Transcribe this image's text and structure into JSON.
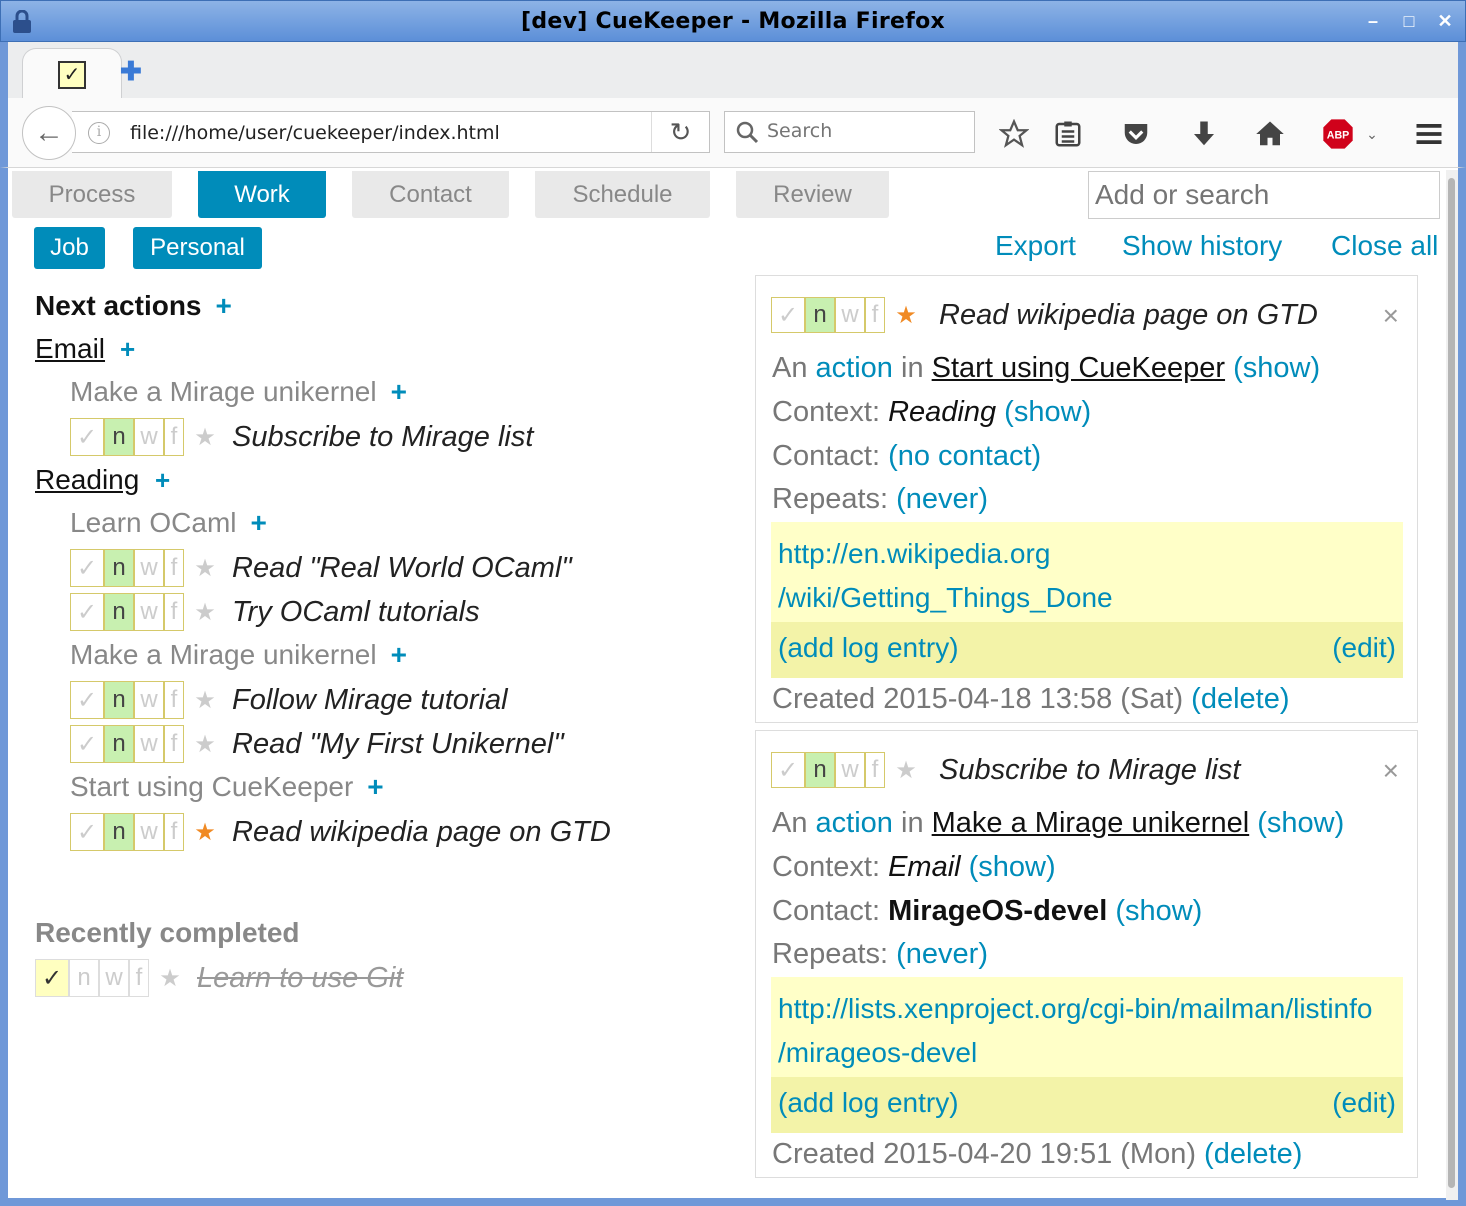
{
  "window": {
    "title": "[dev] CueKeeper - Mozilla Firefox"
  },
  "browser": {
    "tab_favicon": "✓",
    "url": "file:///home/user/cuekeeper/index.html",
    "search_placeholder": "Search",
    "icons": [
      "bookmark-star-icon",
      "reading-list-icon",
      "pocket-icon",
      "download-icon",
      "home-icon",
      "adblock-icon",
      "menu-icon"
    ],
    "adblock_label": "ABP"
  },
  "app": {
    "tabs": [
      {
        "label": "Process"
      },
      {
        "label": "Work"
      },
      {
        "label": "Contact"
      },
      {
        "label": "Schedule"
      },
      {
        "label": "Review"
      }
    ],
    "active_tab": "Work",
    "search_placeholder": "Add or search",
    "filters": [
      {
        "label": "Job"
      },
      {
        "label": "Personal"
      }
    ],
    "links": {
      "export": "Export",
      "history": "Show history",
      "close_all": "Close all"
    }
  },
  "work": {
    "next_actions_title": "Next actions",
    "plus": "+",
    "contexts": [
      {
        "name": "Email",
        "projects": [
          {
            "name": "Make a Mirage unikernel",
            "actions": [
              {
                "title": "Subscribe to Mirage list",
                "starred": false
              }
            ]
          }
        ]
      },
      {
        "name": "Reading",
        "projects": [
          {
            "name": "Learn OCaml",
            "actions": [
              {
                "title": "Read \"Real World OCaml\"",
                "starred": false
              },
              {
                "title": "Try OCaml tutorials",
                "starred": false
              }
            ]
          },
          {
            "name": "Make a Mirage unikernel",
            "actions": [
              {
                "title": "Follow Mirage tutorial",
                "starred": false
              },
              {
                "title": "Read \"My First Unikernel\"",
                "starred": false
              }
            ]
          },
          {
            "name": "Start using CueKeeper",
            "actions": [
              {
                "title": "Read wikipedia page on GTD",
                "starred": true
              }
            ]
          }
        ]
      }
    ],
    "state_letters": {
      "done": "✓",
      "next": "n",
      "waiting": "w",
      "future": "f",
      "star": "★"
    },
    "recently_completed_title": "Recently completed",
    "completed": [
      {
        "title": "Learn to use Git"
      }
    ]
  },
  "panels": [
    {
      "title": "Read wikipedia page on GTD",
      "starred": true,
      "close": "×",
      "action_prefix": "An",
      "action_word": "action",
      "in_word": "in",
      "project": "Start using CueKeeper",
      "show": "(show)",
      "context_label": "Context:",
      "context": "Reading",
      "contact_label": "Contact:",
      "contact": "(no contact)",
      "repeats_label": "Repeats:",
      "repeats": "(never)",
      "notes_line1": "http://en.wikipedia.org",
      "notes_line2": "/wiki/Getting_Things_Done",
      "add_log": "(add log entry)",
      "edit": "(edit)",
      "created": "Created 2015-04-18 13:58 (Sat)",
      "delete": "(delete)"
    },
    {
      "title": "Subscribe to Mirage list",
      "starred": false,
      "close": "×",
      "action_prefix": "An",
      "action_word": "action",
      "in_word": "in",
      "project": "Make a Mirage unikernel",
      "show": "(show)",
      "context_label": "Context:",
      "context": "Email",
      "contact_label": "Contact:",
      "contact": "MirageOS-devel",
      "repeats_label": "Repeats:",
      "repeats": "(never)",
      "notes_line1": "http://lists.xenproject.org/cgi-bin/mailman/listinfo",
      "notes_line2": "/mirageos-devel",
      "add_log": "(add log entry)",
      "edit": "(edit)",
      "created": "Created 2015-04-20 19:51 (Mon)",
      "delete": "(delete)"
    }
  ],
  "colors": {
    "accent": "#008cba",
    "star_on": "#f08a24",
    "next_bg": "#c8f0b0",
    "notes_bg": "#ffffc8"
  }
}
